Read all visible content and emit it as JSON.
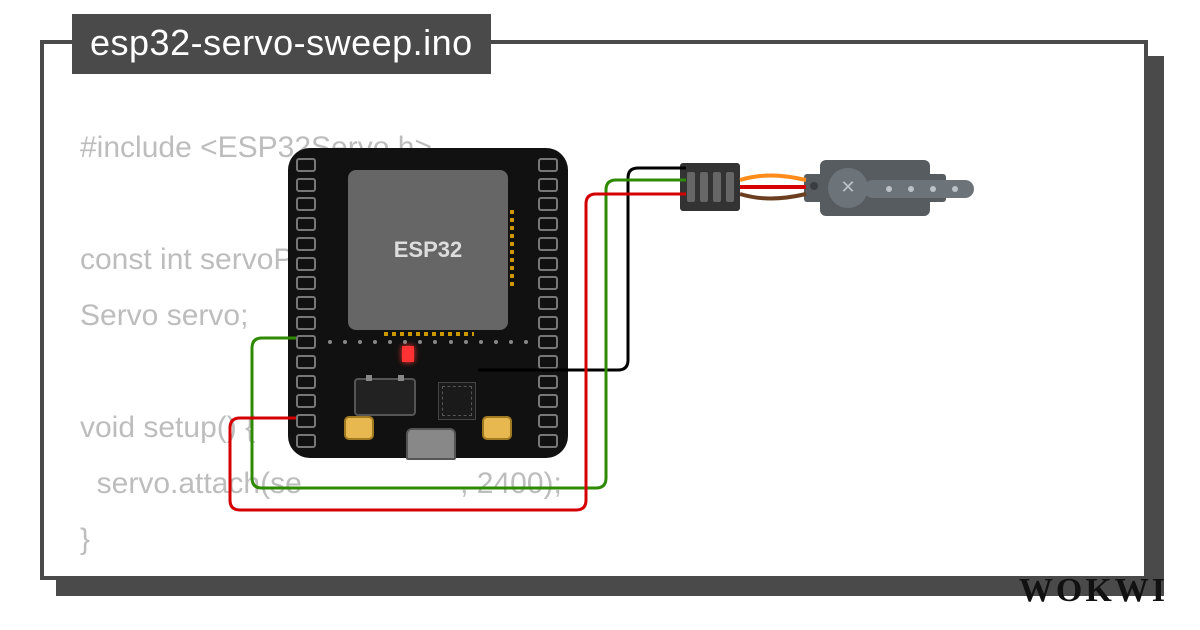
{
  "title": "esp32-servo-sweep.ino",
  "brand": "WOKWI",
  "code": {
    "l1": "#include <ESP32Servo.h>",
    "l2": "",
    "l3": "const int servoPi",
    "l4": "Servo servo;",
    "l5": "",
    "l6": "void setup() {",
    "l7_a": "  servo.attach(se",
    "l7_b": ", 2400);",
    "l8": "}"
  },
  "board": {
    "chip_label": "ESP32"
  },
  "wires": [
    {
      "name": "gnd",
      "color": "#000000",
      "from": "esp32-gnd",
      "to": "servo-gnd"
    },
    {
      "name": "vcc",
      "color": "#d40000",
      "from": "esp32-vin",
      "to": "servo-vcc"
    },
    {
      "name": "pwm",
      "color": "#2e8b00",
      "from": "esp32-d18",
      "to": "servo-sig"
    },
    {
      "name": "servo-lead-brown",
      "color": "#6b3e1f"
    },
    {
      "name": "servo-lead-red",
      "color": "#d40000"
    },
    {
      "name": "servo-lead-orange",
      "color": "#ff8c1a"
    }
  ]
}
